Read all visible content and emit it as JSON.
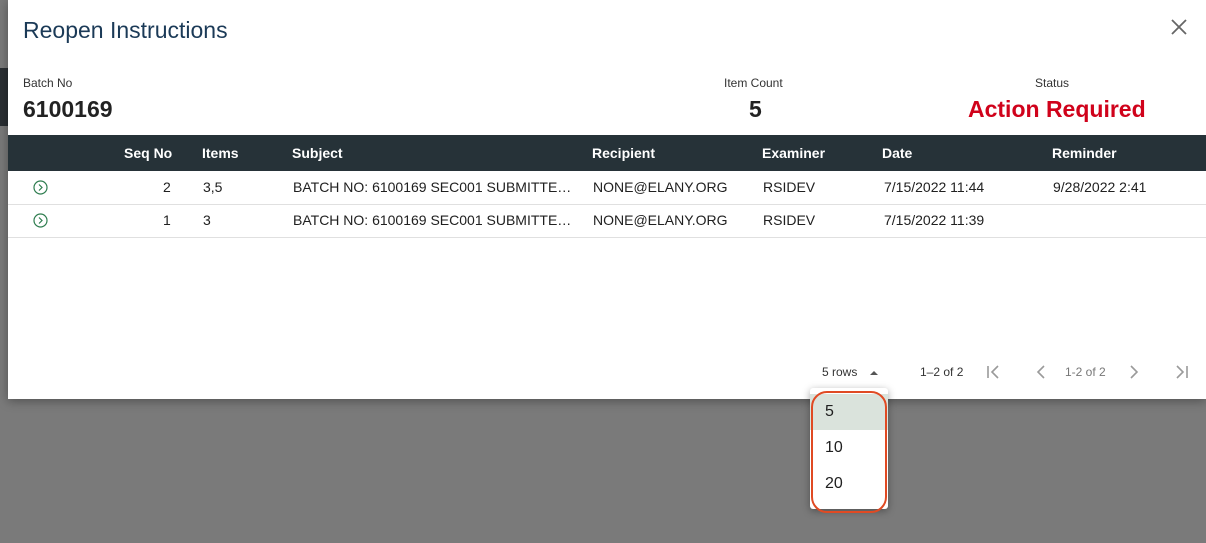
{
  "dialog": {
    "title": "Reopen Instructions"
  },
  "summary": {
    "batch_label": "Batch No",
    "batch_value": "6100169",
    "count_label": "Item Count",
    "count_value": "5",
    "status_label": "Status",
    "status_value": "Action Required",
    "status_color": "#d0021b"
  },
  "table": {
    "headers": {
      "seq": "Seq No",
      "items": "Items",
      "subject": "Subject",
      "recipient": "Recipient",
      "examiner": "Examiner",
      "date": "Date",
      "reminder": "Reminder"
    },
    "rows": [
      {
        "seq": "2",
        "items": "3,5",
        "subject": "BATCH NO: 6100169 SEC001 SUBMITTE…",
        "recipient": "NONE@ELANY.ORG",
        "examiner": "RSIDEV",
        "date": "7/15/2022 11:44",
        "reminder": "9/28/2022 2:41"
      },
      {
        "seq": "1",
        "items": "3",
        "subject": "BATCH NO: 6100169 SEC001 SUBMITTE…",
        "recipient": "NONE@ELANY.ORG",
        "examiner": "RSIDEV",
        "date": "7/15/2022 11:39",
        "reminder": ""
      }
    ],
    "header_bg": "#263238"
  },
  "pagination": {
    "rows_select": "5 rows",
    "range_text": "1–2 of 2",
    "page_text": "1-2 of 2"
  },
  "rows_dropdown": {
    "options": [
      "5",
      "10",
      "20"
    ],
    "selected": "5"
  },
  "icons": {
    "close": "close-icon",
    "expand": "chevron-right-circle-icon",
    "first": "first-page-icon",
    "prev": "chevron-left-icon",
    "next": "chevron-right-icon",
    "last": "last-page-icon",
    "caret": "caret-up-icon"
  }
}
